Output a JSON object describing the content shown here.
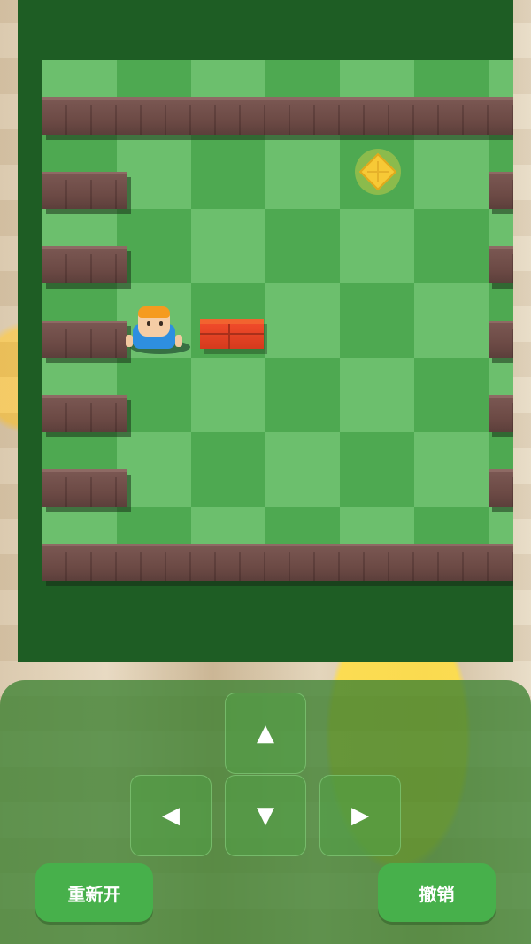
{
  "controls": {
    "up_icon": "▲",
    "down_icon": "▼",
    "left_icon": "◀",
    "right_icon": "▶",
    "restart_label": "重新开",
    "undo_label": "撤销"
  },
  "colors": {
    "board_frame": "#1e5d24",
    "tile_light": "#6cbf6d",
    "tile_dark": "#4ea951",
    "wall": "#6c4a45",
    "box": "#d53a1d",
    "goal": "#f7c936",
    "button": "#47b04b"
  },
  "icons": [
    "up-arrow-icon",
    "down-arrow-icon",
    "left-arrow-icon",
    "right-arrow-icon",
    "goal-diamond-icon"
  ]
}
